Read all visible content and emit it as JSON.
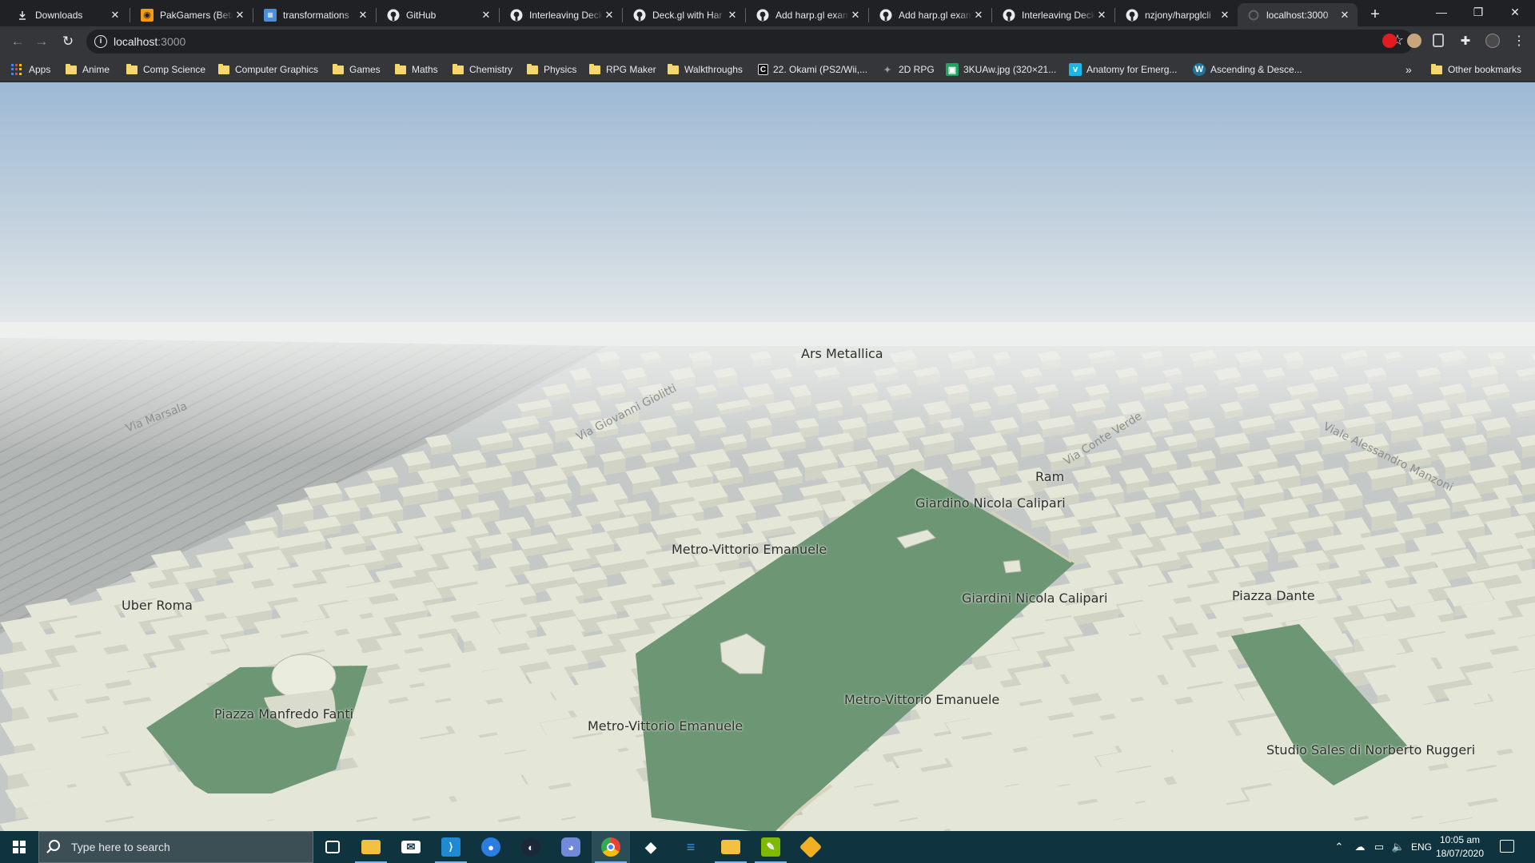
{
  "browser": {
    "tabs": [
      {
        "title": "Downloads",
        "icon": "download-icon"
      },
      {
        "title": "PakGamers (Beta",
        "icon": "pakgamers-icon"
      },
      {
        "title": "transformations",
        "icon": "docs-icon"
      },
      {
        "title": "GitHub",
        "icon": "github-icon"
      },
      {
        "title": "Interleaving Deck",
        "icon": "github-icon"
      },
      {
        "title": "Deck.gl with Har",
        "icon": "github-icon"
      },
      {
        "title": "Add harp.gl exam",
        "icon": "github-icon"
      },
      {
        "title": "Add harp.gl exam",
        "icon": "github-icon"
      },
      {
        "title": "Interleaving Deck",
        "icon": "github-icon"
      },
      {
        "title": "nzjony/harpglcli",
        "icon": "github-icon"
      },
      {
        "title": "localhost:3000",
        "icon": "loading-icon",
        "active": true
      }
    ],
    "address": {
      "host": "localhost",
      "port": ":3000"
    },
    "bookmarks": [
      {
        "label": "Apps",
        "type": "apps"
      },
      {
        "label": "Anime",
        "type": "folder"
      },
      {
        "label": "Comp Science",
        "type": "folder"
      },
      {
        "label": "Computer Graphics",
        "type": "folder"
      },
      {
        "label": "Games",
        "type": "folder"
      },
      {
        "label": "Maths",
        "type": "folder"
      },
      {
        "label": "Chemistry",
        "type": "folder"
      },
      {
        "label": "Physics",
        "type": "folder"
      },
      {
        "label": "RPG Maker",
        "type": "folder"
      },
      {
        "label": "Walkthroughs",
        "type": "folder"
      },
      {
        "label": "22. Okami (PS2/Wii,...",
        "type": "site"
      },
      {
        "label": "2D RPG",
        "type": "site"
      },
      {
        "label": "3KUAw.jpg (320×21...",
        "type": "site"
      },
      {
        "label": "Anatomy for Emerg...",
        "type": "site"
      },
      {
        "label": "Ascending & Desce...",
        "type": "site"
      }
    ],
    "bookmarks_overflow": "»",
    "other_bookmarks": "Other bookmarks"
  },
  "map": {
    "place_labels": [
      {
        "text": "Ars Metallica"
      },
      {
        "text": "Ram"
      },
      {
        "text": "Giardino Nicola Calipari"
      },
      {
        "text": "Metro-Vittorio Emanuele"
      },
      {
        "text": "Giardini Nicola Calipari"
      },
      {
        "text": "Piazza Dante"
      },
      {
        "text": "Uber Roma"
      },
      {
        "text": "Piazza Manfredo Fanti"
      },
      {
        "text": "Metro-Vittorio Emanuele"
      },
      {
        "text": "Metro-Vittorio Emanuele"
      },
      {
        "text": "Studio Sales di Norberto Ruggeri"
      }
    ],
    "street_labels": [
      {
        "text": "Via Marsala"
      },
      {
        "text": "Via Giovanni Giolitti"
      },
      {
        "text": "Via Conte Verde"
      },
      {
        "text": "Viale Alessandro Manzoni"
      }
    ],
    "colors": {
      "sky_top": "#9db9d4",
      "horizon": "#eef0ee",
      "ground": "#c4c9c7",
      "building": "#e4e6d8",
      "park": "#6c9674"
    }
  },
  "taskbar": {
    "search_placeholder": "Type here to search",
    "apps": [
      "task-view-icon",
      "file-explorer-icon",
      "mail-icon",
      "vscode-icon",
      "maps-icon",
      "steam-icon",
      "discord-icon",
      "chrome-icon",
      "gitkraken-icon",
      "azure-icon",
      "folder-icon",
      "notepad-icon",
      "git-icon"
    ],
    "tray": {
      "language": "ENG",
      "time": "10:05 am",
      "date": "18/07/2020"
    }
  }
}
